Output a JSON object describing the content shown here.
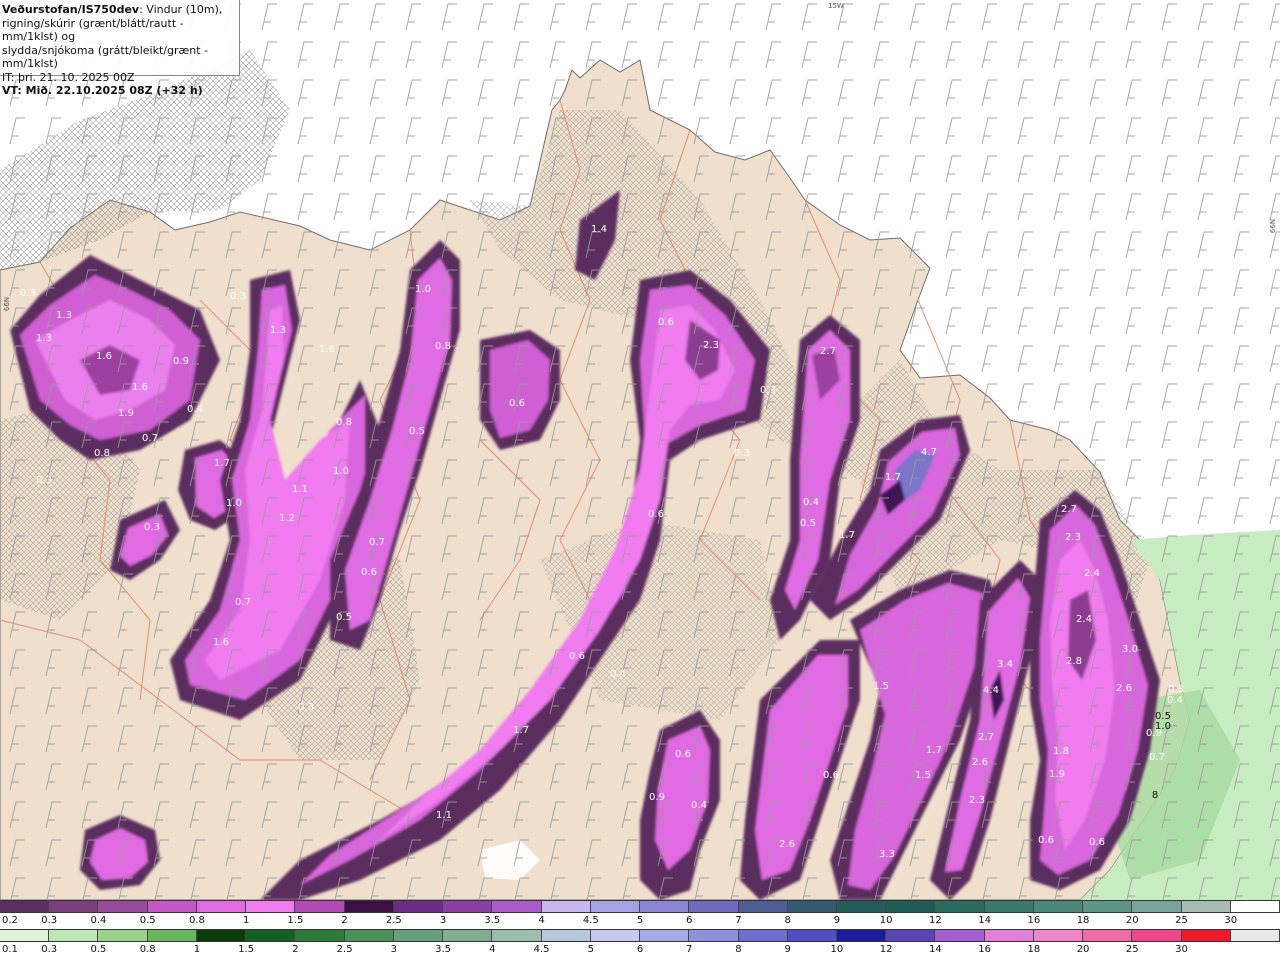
{
  "info": {
    "model": "Veðurstofan/IS750dev",
    "desc1": ": Vindur (10m),",
    "desc2": "rigning/skúrir (grænt/blátt/rautt - mm/1klst) og",
    "desc3": "slydda/snjókoma (grátt/bleikt/grænt - mm/1klst)",
    "issue": "IT: þri. 21. 10. 2025 00Z",
    "valid": "VT: Mið. 22.10.2025 08Z (+32 h)"
  },
  "meridians": {
    "top": "15W",
    "right": "66N",
    "left": "66N"
  },
  "colors": {
    "sea": "#ffffff",
    "land": "#efdfcc",
    "rain_green": "#c8ecc2",
    "snow_dark": "#5c2d5f",
    "snow_mid": "#9e3da0",
    "snow_light": "#e36ee6",
    "snow_bright": "#f07cf0",
    "snow_blue": "#7d75c9",
    "borders": "#e0846a"
  },
  "map_labels": [
    "0.3",
    "1.3",
    "1.3",
    "1.6",
    "1.6",
    "1.9",
    "0.7",
    "0.8",
    "0.3",
    "0.9",
    "0.4",
    "1.7",
    "1.0",
    "0.3",
    "1.3",
    "0.3",
    "1.6",
    "0.8",
    "1.0",
    "1.1",
    "1.2",
    "0.7",
    "0.6",
    "0.5",
    "1.6",
    "0.7",
    "0.3",
    "1.0",
    "0.8",
    "0.5",
    "0.6",
    "1.4",
    "0.6",
    "2.3",
    "0.3",
    "0.3",
    "2.7",
    "0.4",
    "0.5",
    "1.7",
    "1.7",
    "4.7",
    "0.6",
    "0.6",
    "1.7",
    "0.4",
    "0.6",
    "0.9",
    "0.4",
    "1.1",
    "2.6",
    "0.6",
    "3.3",
    "1.5",
    "1.7",
    "1.5",
    "3.4",
    "4.4",
    "2.7",
    "2.6",
    "2.3",
    "2.7",
    "2.3",
    "2.4",
    "2.4",
    "2.8",
    "3.0",
    "2.6",
    "0.3",
    "0.5",
    "1.8",
    "1.9",
    "0.6",
    "0.6",
    "0.4",
    "0.9",
    "1.0",
    "0.7",
    "8"
  ],
  "legend_snow": {
    "labels": [
      "0.2",
      "0.3",
      "0.4",
      "0.5",
      "0.8",
      "1",
      "1.5",
      "2",
      "2.5",
      "3",
      "3.5",
      "4",
      "4.5",
      "5",
      "6",
      "7",
      "8",
      "9",
      "10",
      "12",
      "14",
      "16",
      "18",
      "20",
      "25",
      "30"
    ],
    "colors": [
      "#5c2d5f",
      "#7a3e7d",
      "#9a4a9c",
      "#c457c7",
      "#e06ae2",
      "#ef7df0",
      "#b04ab5",
      "#3d0f45",
      "#6b2c86",
      "#8b3fa5",
      "#a85ccc",
      "#c8b6ee",
      "#a5a2e2",
      "#8a86d3",
      "#6f6cbf",
      "#4e5d94",
      "#345a6f",
      "#235b5b",
      "#1f5a55",
      "#2c6a60",
      "#3a7a6a",
      "#4c877c",
      "#5e958a",
      "#7aa49a",
      "#a5bbb4",
      "#ffffff"
    ]
  },
  "legend_rain": {
    "labels": [
      "0.1",
      "0.3",
      "0.5",
      "0.8",
      "1",
      "1.5",
      "2",
      "2.5",
      "3",
      "3.5",
      "4",
      "4.5",
      "5",
      "6",
      "7",
      "8",
      "9",
      "10",
      "12",
      "14",
      "16",
      "18",
      "20",
      "25",
      "30"
    ],
    "colors": [
      "#dff5da",
      "#bfe6b6",
      "#9ad38e",
      "#6cb55f",
      "#0b3d0b",
      "#175e22",
      "#2f7a3a",
      "#4b8f5a",
      "#65a07a",
      "#7fae93",
      "#9cbcb0",
      "#b6c8dc",
      "#c9c9ef",
      "#a9a9e6",
      "#8f8fdc",
      "#6e6ed0",
      "#4f4fc3",
      "#1c1ca0",
      "#5a45b7",
      "#a35fd2",
      "#e47fd9",
      "#ef86c7",
      "#f06aa6",
      "#f0478a",
      "#f01a2c",
      "#e8e8e8"
    ]
  }
}
